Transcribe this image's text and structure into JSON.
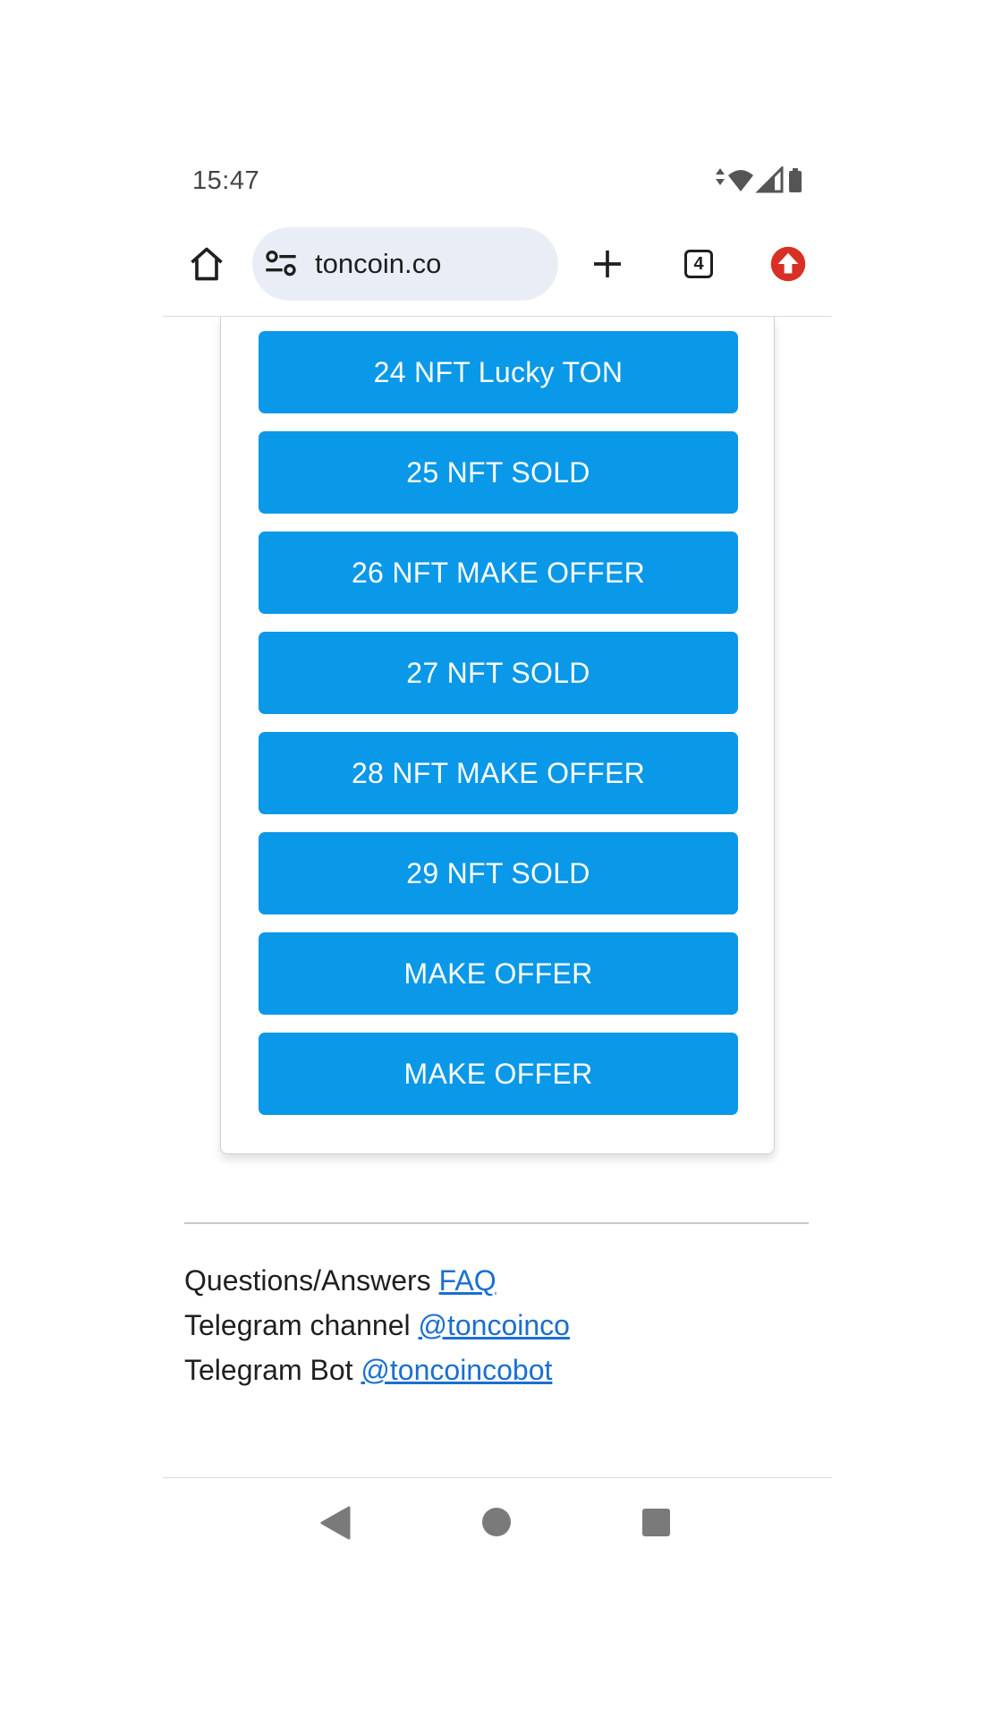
{
  "status_bar": {
    "time": "15:47"
  },
  "browser": {
    "url": "toncoin.co",
    "tab_count": "4",
    "icons": {
      "home": "home-icon",
      "site_settings": "tune-icon",
      "new_tab": "plus-icon",
      "tabs": "tabs-icon",
      "update": "update-available-icon"
    },
    "update_color": "#d93025"
  },
  "nft_buttons": [
    "24 NFT Lucky TON",
    "25 NFT SOLD",
    "26 NFT MAKE OFFER",
    "27 NFT SOLD",
    "28 NFT MAKE OFFER",
    "29 NFT SOLD",
    "MAKE OFFER",
    "MAKE OFFER"
  ],
  "button_color": "#0a98e8",
  "footer": {
    "faq_prefix": "Questions/Answers",
    "faq_link": "FAQ",
    "channel_prefix": "Telegram channel",
    "channel_link": "@toncoinco",
    "bot_prefix": "Telegram Bot",
    "bot_link": "@toncoincobot",
    "link_color": "#1a6fd1"
  },
  "nav": {
    "back": "back-triangle-icon",
    "home": "home-circle-icon",
    "recents": "recents-square-icon"
  }
}
